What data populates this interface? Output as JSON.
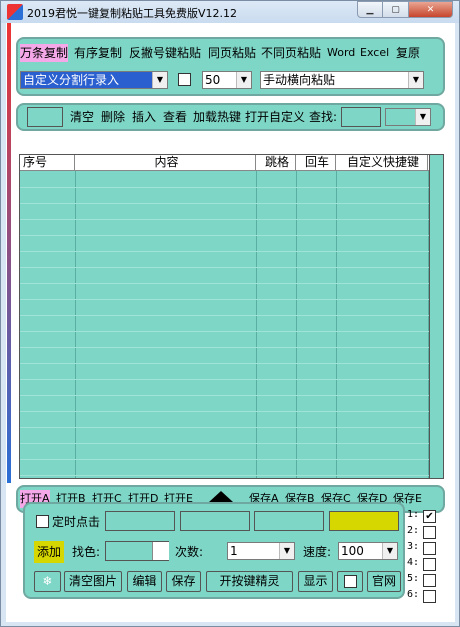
{
  "title": "2019君悦一键复制粘贴工具免费版V12.12",
  "toolbar1": {
    "buttons": [
      "万条复制",
      "有序复制",
      "反撇号键粘贴",
      "同页粘贴",
      "不同页粘贴",
      "Word",
      "Excel",
      "复原"
    ],
    "mode_select": "自定义分割行录入",
    "count_select": "50",
    "paste_mode_select": "手动横向粘贴"
  },
  "toolbar2": {
    "buttons": [
      "清空",
      "删除",
      "插入",
      "查看",
      "加载热键",
      "打开自定义"
    ],
    "search_label": "查找:"
  },
  "table": {
    "columns": [
      "序号",
      "内容",
      "跳格",
      "回车",
      "自定义快捷键"
    ]
  },
  "save_bar": {
    "open_buttons": [
      "打开A",
      "打开B",
      "打开C",
      "打开D",
      "打开E"
    ],
    "save_buttons": [
      "保存A",
      "保存B",
      "保存C",
      "保存D",
      "保存E"
    ]
  },
  "bottom": {
    "timer_label": "定时点击",
    "add_label": "添加",
    "find_color_label": "找色:",
    "times_label": "次数:",
    "times_value": "1",
    "speed_label": "速度:",
    "speed_value": "100",
    "clear_image_label": "清空图片",
    "edit_label": "编辑",
    "save_label": "保存",
    "open_wizard_label": "开按键精灵",
    "show_label": "显示",
    "website_label": "官网",
    "slots": [
      "1:",
      "2:",
      "3:",
      "4:",
      "5:",
      "6:"
    ]
  }
}
